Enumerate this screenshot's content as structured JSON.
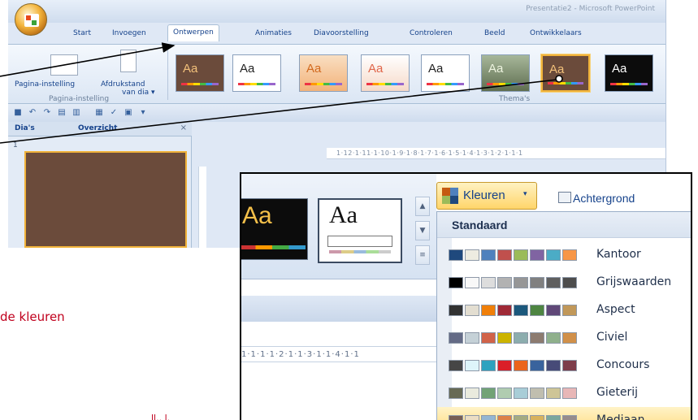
{
  "app": {
    "title": "Presentatie2 - Microsoft PowerPoint",
    "tabs": [
      "Start",
      "Invoegen",
      "Ontwerpen",
      "Animaties",
      "Diavoorstelling",
      "Controleren",
      "Beeld",
      "Ontwikkelaars"
    ],
    "active_tab": "Ontwerpen"
  },
  "ribbon": {
    "page_setup_label": "Pagina-instelling",
    "orientation_label_1": "Afdrukstand",
    "orientation_label_2": "van dia ▾",
    "group_page_setup": "Pagina-instelling",
    "group_themes": "Thema's",
    "theme_thumb_text": "Aa"
  },
  "pane": {
    "tab_slides": "Dia's",
    "tab_outline": "Overzicht",
    "close": "×",
    "slide_number": "1"
  },
  "ruler": {
    "top_text": "1·12·1·11·1·10·1·9·1·8·1·7·1·6·1·5·1·4·1·3·1·2·1·1·1",
    "zoom_text": "1·1·1·1·2·1·1·3·1·1·4·1·1"
  },
  "zoom": {
    "thumb_text": "Aa",
    "scroll_up": "▲",
    "scroll_down": "▼",
    "scroll_more": "≡",
    "colors_button": "Kleuren",
    "colors_caret": "▾",
    "background_button": "Achtergrond"
  },
  "colors_dropdown": {
    "header": "Standaard",
    "schemes": [
      {
        "name": "Kantoor",
        "swatches": [
          "#1f497d",
          "#eeece1",
          "#4f81bd",
          "#c0504d",
          "#9bbb59",
          "#8064a2",
          "#4bacc6",
          "#f79646"
        ]
      },
      {
        "name": "Grijswaarden",
        "swatches": [
          "#000000",
          "#f8f8f8",
          "#dddddd",
          "#b2b2b2",
          "#969696",
          "#808080",
          "#5f5f5f",
          "#4d4d4d"
        ]
      },
      {
        "name": "Aspect",
        "swatches": [
          "#323232",
          "#e3ded1",
          "#f07f09",
          "#9f2936",
          "#1b587c",
          "#4e8542",
          "#604878",
          "#c19859"
        ]
      },
      {
        "name": "Civiel",
        "swatches": [
          "#646b86",
          "#c5d1d7",
          "#d16349",
          "#ccb400",
          "#8cadae",
          "#8c7b70",
          "#8fb08c",
          "#d19049"
        ]
      },
      {
        "name": "Concours",
        "swatches": [
          "#464646",
          "#def5fa",
          "#2da2bf",
          "#da1f28",
          "#eb641b",
          "#39639d",
          "#474b78",
          "#7d3c4a"
        ]
      },
      {
        "name": "Gieterij",
        "swatches": [
          "#676a55",
          "#eaebde",
          "#72a376",
          "#b0ccb0",
          "#a8cdd7",
          "#c0beaf",
          "#cec597",
          "#e8b7b7"
        ]
      },
      {
        "name": "Mediaan",
        "swatches": [
          "#775f55",
          "#ebddc3",
          "#94b6d2",
          "#dd8047",
          "#a5ab81",
          "#d8b25c",
          "#7ba79d",
          "#968c8c"
        ]
      }
    ]
  },
  "annotations": {
    "text_1": "de kleuren",
    "text_2": "ll.. l."
  },
  "colors": {
    "accent_orange": "#f0b23a",
    "annotation_red": "#c0001d",
    "brand_blue": "#15428b"
  }
}
